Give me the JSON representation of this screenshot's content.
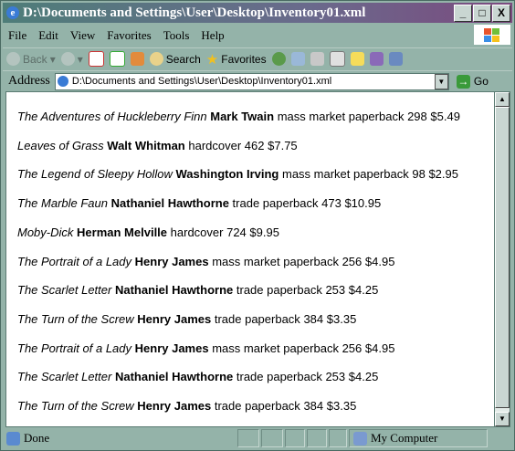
{
  "window": {
    "title": "D:\\Documents and Settings\\User\\Desktop\\Inventory01.xml",
    "minimize": "_",
    "maximize": "□",
    "close": "X"
  },
  "menu": [
    "File",
    "Edit",
    "View",
    "Favorites",
    "Tools",
    "Help"
  ],
  "toolbar": {
    "back": "Back",
    "search": "Search",
    "favorites": "Favorites"
  },
  "address": {
    "label": "Address",
    "value": "D:\\Documents and Settings\\User\\Desktop\\Inventory01.xml",
    "go": "Go"
  },
  "books": [
    {
      "title": "The Adventures of Huckleberry Finn",
      "author": "Mark Twain",
      "binding": "mass market paperback",
      "pages": "298",
      "price": "$5.49"
    },
    {
      "title": "Leaves of Grass",
      "author": "Walt Whitman",
      "binding": "hardcover",
      "pages": "462",
      "price": "$7.75"
    },
    {
      "title": "The Legend of Sleepy Hollow",
      "author": "Washington Irving",
      "binding": "mass market paperback",
      "pages": "98",
      "price": "$2.95"
    },
    {
      "title": "The Marble Faun",
      "author": "Nathaniel Hawthorne",
      "binding": "trade paperback",
      "pages": "473",
      "price": "$10.95"
    },
    {
      "title": "Moby-Dick",
      "author": "Herman Melville",
      "binding": "hardcover",
      "pages": "724",
      "price": "$9.95"
    },
    {
      "title": "The Portrait of a Lady",
      "author": "Henry James",
      "binding": "mass market paperback",
      "pages": "256",
      "price": "$4.95"
    },
    {
      "title": "The Scarlet Letter",
      "author": "Nathaniel Hawthorne",
      "binding": "trade paperback",
      "pages": "253",
      "price": "$4.25"
    },
    {
      "title": "The Turn of the Screw",
      "author": "Henry James",
      "binding": "trade paperback",
      "pages": "384",
      "price": "$3.35"
    },
    {
      "title": "The Portrait of a Lady",
      "author": "Henry James",
      "binding": "mass market paperback",
      "pages": "256",
      "price": "$4.95"
    },
    {
      "title": "The Scarlet Letter",
      "author": "Nathaniel Hawthorne",
      "binding": "trade paperback",
      "pages": "253",
      "price": "$4.25"
    },
    {
      "title": "The Turn of the Screw",
      "author": "Henry James",
      "binding": "trade paperback",
      "pages": "384",
      "price": "$3.35"
    }
  ],
  "status": {
    "text": "Done",
    "zone": "My Computer"
  }
}
